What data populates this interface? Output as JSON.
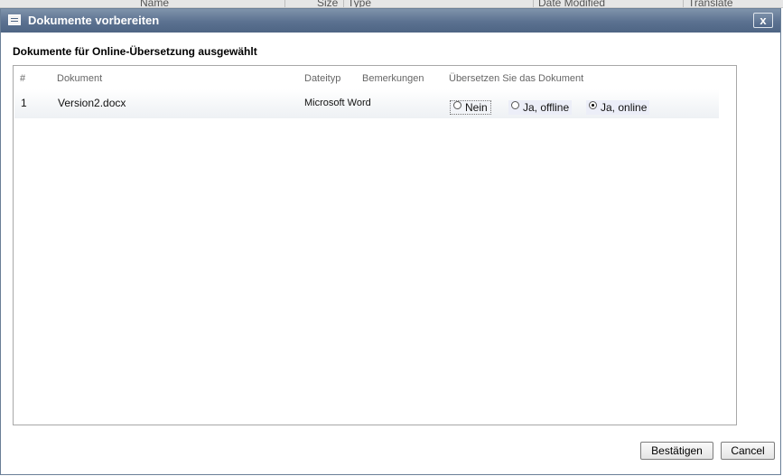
{
  "background_header": {
    "columns": [
      "Name",
      "Size",
      "Type",
      "Date Modified",
      "Translate"
    ]
  },
  "dialog": {
    "title": "Dokumente vorbereiten",
    "close_label": "x",
    "section_title": "Dokumente für Online-Übersetzung ausgewählt",
    "table": {
      "headers": {
        "number": "#",
        "document": "Dokument",
        "filetype": "Dateityp",
        "remarks": "Bemerkungen",
        "translate": "Übersetzen Sie das Dokument"
      },
      "rows": [
        {
          "number": "1",
          "document": "Version2.docx",
          "filetype": "Microsoft Word",
          "remarks": "",
          "options": [
            {
              "label": "Nein",
              "checked": false
            },
            {
              "label": "Ja, offline",
              "checked": false
            },
            {
              "label": "Ja, online",
              "checked": true
            }
          ]
        }
      ]
    },
    "buttons": {
      "confirm": "Bestätigen",
      "cancel": "Cancel"
    }
  },
  "colors": {
    "titlebar": "#5b7190",
    "frame_border": "#a8a8a8"
  }
}
